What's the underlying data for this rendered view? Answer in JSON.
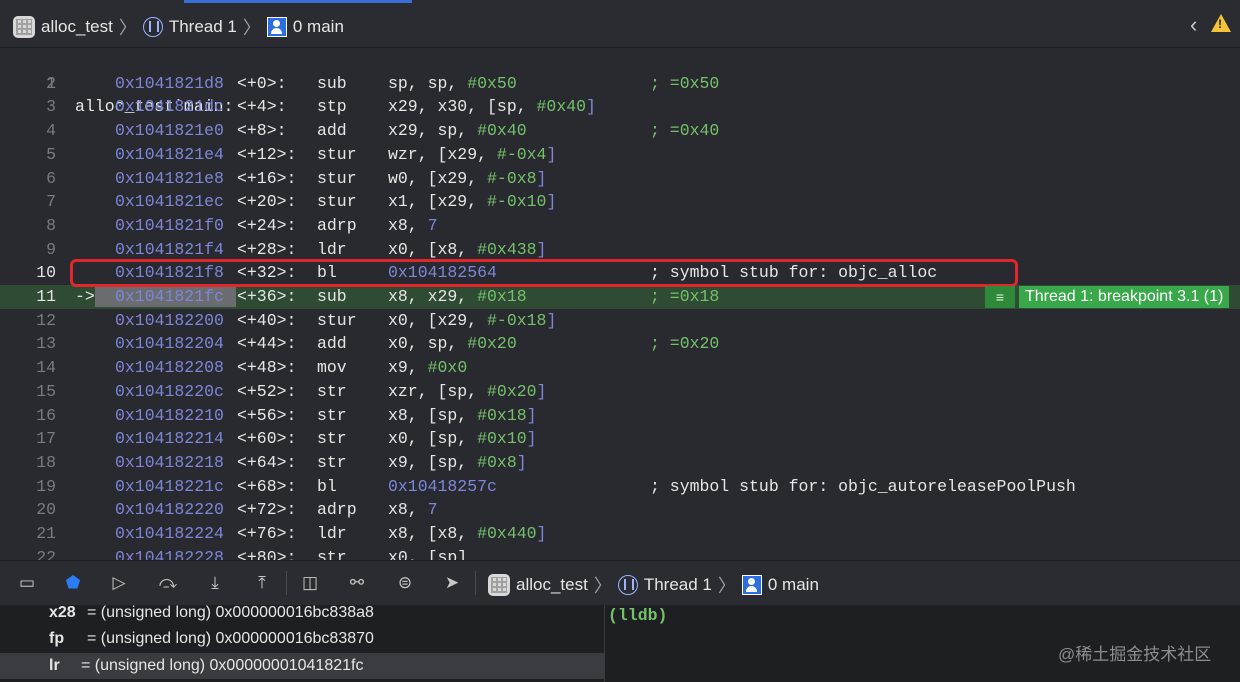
{
  "breadcrumb": {
    "target": "alloc_test",
    "thread": "Thread 1",
    "frame": "0 main"
  },
  "colors": {
    "background": "#292a30",
    "address": "#7f86d8",
    "immediate": "#74c16a",
    "breakpoint": "#39a84a",
    "highlight_box": "#e0282c"
  },
  "editor": {
    "title_line_number": "1",
    "function_title": "alloc_test`main:",
    "pc_arrow": "->",
    "lines": [
      {
        "n": "2",
        "addr": "0x1041821d8",
        "off": "<+0>:",
        "mn": "sub",
        "ops": "sp, sp, ",
        "imm": "#0x50",
        "post": "",
        "cmt": "; =0x50",
        "cmt_green": true
      },
      {
        "n": "3",
        "addr": "0x1041821dc",
        "off": "<+4>:",
        "mn": "stp",
        "ops": "x29, x30, [sp, ",
        "imm": "#0x40",
        "post": "]",
        "cmt": "",
        "cmt_green": true
      },
      {
        "n": "4",
        "addr": "0x1041821e0",
        "off": "<+8>:",
        "mn": "add",
        "ops": "x29, sp, ",
        "imm": "#0x40",
        "post": "",
        "cmt": "; =0x40",
        "cmt_green": true
      },
      {
        "n": "5",
        "addr": "0x1041821e4",
        "off": "<+12>:",
        "mn": "stur",
        "ops": "wzr, [x29, ",
        "imm": "#-0x4",
        "post": "]",
        "cmt": "",
        "cmt_green": true
      },
      {
        "n": "6",
        "addr": "0x1041821e8",
        "off": "<+16>:",
        "mn": "stur",
        "ops": "w0, [x29, ",
        "imm": "#-0x8",
        "post": "]",
        "cmt": "",
        "cmt_green": true
      },
      {
        "n": "7",
        "addr": "0x1041821ec",
        "off": "<+20>:",
        "mn": "stur",
        "ops": "x1, [x29, ",
        "imm": "#-0x10",
        "post": "]",
        "cmt": "",
        "cmt_green": true
      },
      {
        "n": "8",
        "addr": "0x1041821f0",
        "off": "<+24>:",
        "mn": "adrp",
        "ops": "x8, ",
        "imm": "7",
        "post": "",
        "cmt": "",
        "cmt_green": true,
        "imm_purple": true
      },
      {
        "n": "9",
        "addr": "0x1041821f4",
        "off": "<+28>:",
        "mn": "ldr",
        "ops": "x0, [x8, ",
        "imm": "#0x438",
        "post": "]",
        "cmt": "",
        "cmt_green": true
      },
      {
        "n": "10",
        "addr": "0x1041821f8",
        "off": "<+32>:",
        "mn": "bl",
        "ops": "",
        "imm": "0x104182564",
        "post": "",
        "cmt": "; symbol stub for: objc_alloc",
        "cmt_green": false,
        "imm_purple": true,
        "highlight": true
      },
      {
        "n": "11",
        "addr": "0x1041821fc",
        "off": "<+36>:",
        "mn": "sub",
        "ops": "x8, x29, ",
        "imm": "#0x18",
        "post": "",
        "cmt": "; =0x18",
        "cmt_green": true,
        "current": true
      },
      {
        "n": "12",
        "addr": "0x104182200",
        "off": "<+40>:",
        "mn": "stur",
        "ops": "x0, [x29, ",
        "imm": "#-0x18",
        "post": "]",
        "cmt": "",
        "cmt_green": true
      },
      {
        "n": "13",
        "addr": "0x104182204",
        "off": "<+44>:",
        "mn": "add",
        "ops": "x0, sp, ",
        "imm": "#0x20",
        "post": "",
        "cmt": "; =0x20",
        "cmt_green": true
      },
      {
        "n": "14",
        "addr": "0x104182208",
        "off": "<+48>:",
        "mn": "mov",
        "ops": "x9, ",
        "imm": "#0x0",
        "post": "",
        "cmt": "",
        "cmt_green": true
      },
      {
        "n": "15",
        "addr": "0x10418220c",
        "off": "<+52>:",
        "mn": "str",
        "ops": "xzr, [sp, ",
        "imm": "#0x20",
        "post": "]",
        "cmt": "",
        "cmt_green": true
      },
      {
        "n": "16",
        "addr": "0x104182210",
        "off": "<+56>:",
        "mn": "str",
        "ops": "x8, [sp, ",
        "imm": "#0x18",
        "post": "]",
        "cmt": "",
        "cmt_green": true
      },
      {
        "n": "17",
        "addr": "0x104182214",
        "off": "<+60>:",
        "mn": "str",
        "ops": "x0, [sp, ",
        "imm": "#0x10",
        "post": "]",
        "cmt": "",
        "cmt_green": true
      },
      {
        "n": "18",
        "addr": "0x104182218",
        "off": "<+64>:",
        "mn": "str",
        "ops": "x9, [sp, ",
        "imm": "#0x8",
        "post": "]",
        "cmt": "",
        "cmt_green": true
      },
      {
        "n": "19",
        "addr": "0x10418221c",
        "off": "<+68>:",
        "mn": "bl",
        "ops": "",
        "imm": "0x10418257c",
        "post": "",
        "cmt": "; symbol stub for: objc_autoreleasePoolPush",
        "cmt_green": false,
        "imm_purple": true
      },
      {
        "n": "20",
        "addr": "0x104182220",
        "off": "<+72>:",
        "mn": "adrp",
        "ops": "x8, ",
        "imm": "7",
        "post": "",
        "cmt": "",
        "cmt_green": true,
        "imm_purple": true
      },
      {
        "n": "21",
        "addr": "0x104182224",
        "off": "<+76>:",
        "mn": "ldr",
        "ops": "x8, [x8, ",
        "imm": "#0x440",
        "post": "]",
        "cmt": "",
        "cmt_green": true
      },
      {
        "n": "22",
        "addr": "0x104182228",
        "off": "<+80>:",
        "mn": "str",
        "ops": "x0, [sp]",
        "imm": "",
        "post": "",
        "cmt": "",
        "cmt_green": true
      }
    ],
    "breakpoint_label": "Thread 1: breakpoint 3.1 (1)"
  },
  "debug_toolbar": {
    "icons": [
      "hide-debug-area-icon",
      "breakpoints-toggle-icon",
      "continue-icon",
      "step-over-icon",
      "step-into-icon",
      "step-out-icon",
      "view-hierarchy-icon",
      "memory-graph-icon",
      "environment-overrides-icon",
      "location-icon"
    ]
  },
  "variables": [
    {
      "name": "x28",
      "value": "= (unsigned long) 0x000000016bc838a8"
    },
    {
      "name": "fp",
      "value": "= (unsigned long) 0x000000016bc83870"
    },
    {
      "name": "lr",
      "value": "= (unsigned long) 0x00000001041821fc",
      "selected": true
    }
  ],
  "console": {
    "prompt": "(lldb)"
  },
  "watermark": "@稀土掘金技术社区"
}
